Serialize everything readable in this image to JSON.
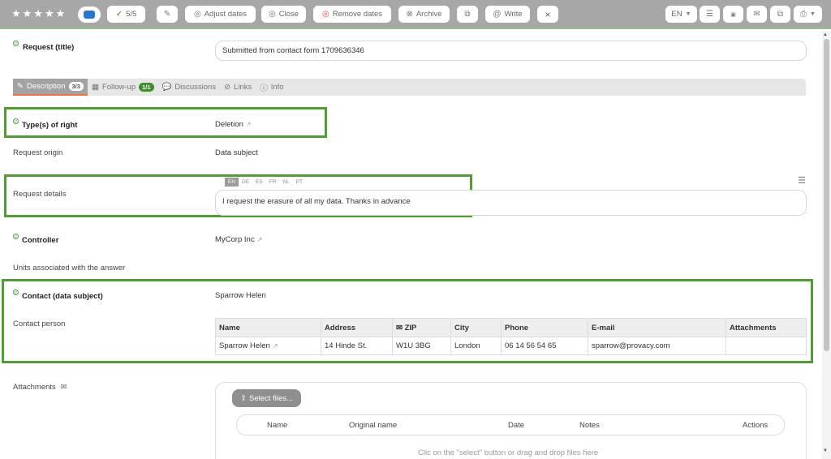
{
  "toolbar": {
    "stars": "★★★★★",
    "check_count": "5/5",
    "adjust_dates": "Adjust dates",
    "close": "Close",
    "remove_dates": "Remove dates",
    "archive": "Archive",
    "write": "Write",
    "dismiss": "×",
    "language": "EN",
    "rating_value": 5
  },
  "request_title": {
    "label": "Request (title)",
    "value": "Submitted from contact form 1709636346"
  },
  "tabs": [
    {
      "label": "Description",
      "badge": "3/3"
    },
    {
      "label": "Follow-up",
      "badge": "1/1"
    },
    {
      "label": "Discussions"
    },
    {
      "label": "Links"
    },
    {
      "label": "Info"
    }
  ],
  "fields": {
    "rights_label": "Type(s) of right",
    "rights_value": "Deletion",
    "origin_label": "Request origin",
    "origin_value": "Data subject",
    "details_label": "Request details",
    "details_value": "I request the erasure of all my data. Thanks in advance",
    "controller_label": "Controller",
    "controller_value": "MyCorp Inc",
    "units_label": "Units associated with the answer",
    "contact_label": "Contact (data subject)",
    "contact_value": "Sparrow Helen",
    "contact_person_label": "Contact person",
    "attachments_label": "Attachments"
  },
  "languages": [
    "EN",
    "DE",
    "ES",
    "FR",
    "NL",
    "PT"
  ],
  "contact_table": {
    "headers": [
      "Name",
      "Address",
      "✉ ZIP",
      "City",
      "Phone",
      "E-mail",
      "Attachments"
    ],
    "rows": [
      [
        "Sparrow Helen",
        "14 Hinde St.",
        "W1U 3BG",
        "London",
        "06 14 56 54 65",
        "sparrow@provacy.com",
        ""
      ]
    ]
  },
  "attachments": {
    "select_button": "Select files...",
    "headers": [
      "Name",
      "Original name",
      "Date",
      "Notes",
      "Actions"
    ],
    "hint": "Clic on the \"select\" button or drag and drop files here"
  },
  "colors": {
    "highlight": "#4e9e34",
    "accent": "#ff6a3d",
    "badge": "#3c8f2a",
    "tag": "#2575d8"
  }
}
